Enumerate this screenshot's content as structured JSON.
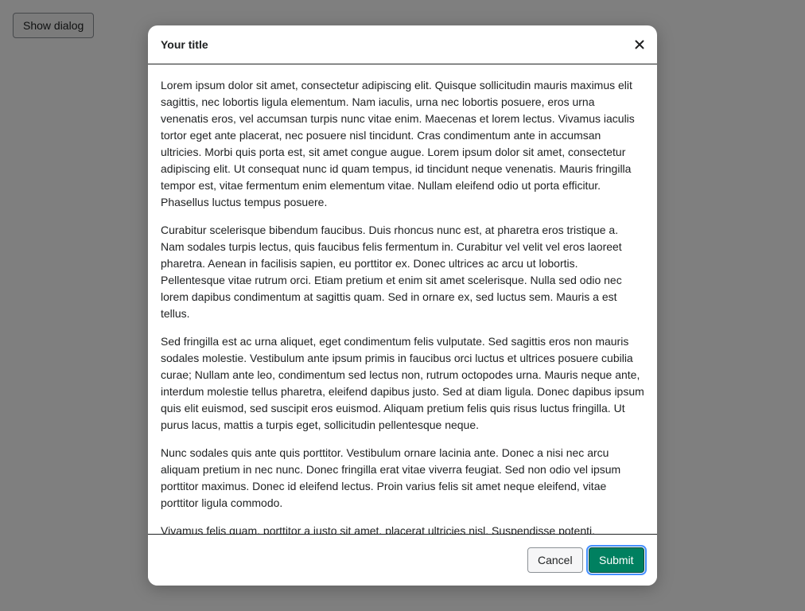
{
  "page": {
    "show_dialog_label": "Show dialog"
  },
  "dialog": {
    "title": "Your title",
    "close_icon": "close-icon",
    "paragraphs": [
      "Lorem ipsum dolor sit amet, consectetur adipiscing elit. Quisque sollicitudin mauris maximus elit sagittis, nec lobortis ligula elementum. Nam iaculis, urna nec lobortis posuere, eros urna venenatis eros, vel accumsan turpis nunc vitae enim. Maecenas et lorem lectus. Vivamus iaculis tortor eget ante placerat, nec posuere nisl tincidunt. Cras condimentum ante in accumsan ultricies. Morbi quis porta est, sit amet congue augue. Lorem ipsum dolor sit amet, consectetur adipiscing elit. Ut consequat nunc id quam tempus, id tincidunt neque venenatis. Mauris fringilla tempor est, vitae fermentum enim elementum vitae. Nullam eleifend odio ut porta efficitur. Phasellus luctus tempus posuere.",
      "Curabitur scelerisque bibendum faucibus. Duis rhoncus nunc est, at pharetra eros tristique a. Nam sodales turpis lectus, quis faucibus felis fermentum in. Curabitur vel velit vel eros laoreet pharetra. Aenean in facilisis sapien, eu porttitor ex. Donec ultrices ac arcu ut lobortis. Pellentesque vitae rutrum orci. Etiam pretium et enim sit amet scelerisque. Nulla sed odio nec lorem dapibus condimentum at sagittis quam. Sed in ornare ex, sed luctus sem. Mauris a est tellus.",
      "Sed fringilla est ac urna aliquet, eget condimentum felis vulputate. Sed sagittis eros non mauris sodales molestie. Vestibulum ante ipsum primis in faucibus orci luctus et ultrices posuere cubilia curae; Nullam ante leo, condimentum sed lectus non, rutrum octopodes urna. Mauris neque ante, interdum molestie tellus pharetra, eleifend dapibus justo. Sed at diam ligula. Donec dapibus ipsum quis elit euismod, sed suscipit eros euismod. Aliquam pretium felis quis risus luctus fringilla. Ut purus lacus, mattis a turpis eget, sollicitudin pellentesque neque.",
      "Nunc sodales quis ante quis porttitor. Vestibulum ornare lacinia ante. Donec a nisi nec arcu aliquam pretium in nec nunc. Donec fringilla erat vitae viverra feugiat. Sed non odio vel ipsum porttitor maximus. Donec id eleifend lectus. Proin varius felis sit amet neque eleifend, vitae porttitor ligula commodo.",
      "Vivamus felis quam, porttitor a justo sit amet, placerat ultricies nisl. Suspendisse potenti."
    ],
    "cancel_label": "Cancel",
    "submit_label": "Submit"
  },
  "colors": {
    "backdrop": "rgba(0,0,0,0.5)",
    "primary": "#008060",
    "focus_ring": "#458fff",
    "text": "#202223"
  }
}
